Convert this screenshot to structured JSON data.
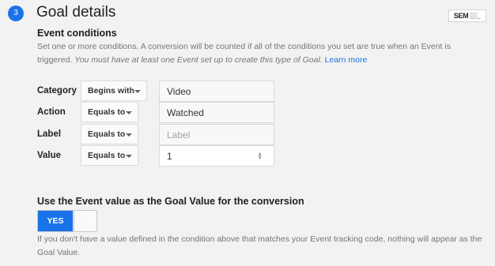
{
  "step": {
    "number": "3",
    "title": "Goal details"
  },
  "brand": {
    "logo_text": "SEM",
    "logo_tagline": "Search Engine Marketing"
  },
  "event_conditions": {
    "heading": "Event conditions",
    "description_plain": "Set one or more conditions. A conversion will be counted if all of the conditions you set are true when an Event is triggered.",
    "description_italic": "You must have at least one Event set up to create this type of Goal.",
    "learn_more": "Learn more",
    "rows": [
      {
        "label": "Category",
        "operator": "Begins with",
        "value": "Video",
        "placeholder": ""
      },
      {
        "label": "Action",
        "operator": "Equals to",
        "value": "Watched",
        "placeholder": ""
      },
      {
        "label": "Label",
        "operator": "Equals to",
        "value": "",
        "placeholder": "Label"
      },
      {
        "label": "Value",
        "operator": "Equals to",
        "value": "1",
        "placeholder": ""
      }
    ]
  },
  "goal_value": {
    "heading": "Use the Event value as the Goal Value for the conversion",
    "toggle_label": "YES",
    "toggle_on": true,
    "note": "If you don't have a value defined in the condition above that matches your Event tracking code, nothing will appear as the Goal Value."
  },
  "colors": {
    "accent": "#1a73e8",
    "background": "#f2f2f2",
    "muted_text": "#757575"
  },
  "icons": {
    "dropdown": "chevron-down-icon",
    "spinner": "number-spinner-icon"
  }
}
